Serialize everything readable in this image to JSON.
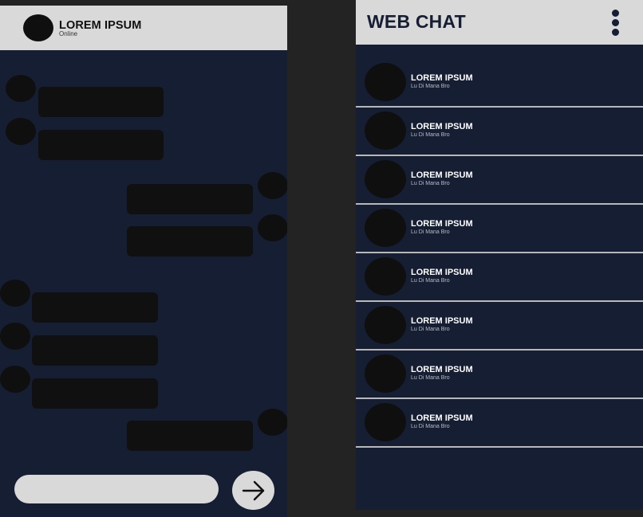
{
  "chat": {
    "contact_name": "LOREM IPSUM",
    "status": "Online",
    "input_placeholder": "",
    "send_icon": "arrow-right-icon"
  },
  "contacts": {
    "title": "WEB CHAT",
    "menu_icon": "kebab-menu-icon",
    "items": [
      {
        "name": "LOREM IPSUM",
        "subtitle": "Lu Di Mana Bro"
      },
      {
        "name": "LOREM IPSUM",
        "subtitle": "Lu Di Mana Bro"
      },
      {
        "name": "LOREM IPSUM",
        "subtitle": "Lu Di Mana Bro"
      },
      {
        "name": "LOREM IPSUM",
        "subtitle": "Lu Di Mana Bro"
      },
      {
        "name": "LOREM IPSUM",
        "subtitle": "Lu Di Mana Bro"
      },
      {
        "name": "LOREM IPSUM",
        "subtitle": "Lu Di Mana Bro"
      },
      {
        "name": "LOREM IPSUM",
        "subtitle": "Lu Di Mana Bro"
      },
      {
        "name": "LOREM IPSUM",
        "subtitle": "Lu Di Mana Bro"
      }
    ]
  },
  "colors": {
    "dark_navy": "#161e34",
    "header_gray": "#d9d9d9",
    "bubble": "#101010",
    "divider": "#b8b8b8"
  }
}
